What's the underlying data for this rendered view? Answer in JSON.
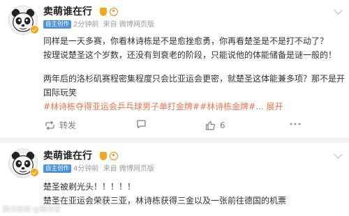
{
  "posts": [
    {
      "author": "卖萌谁在行",
      "tag": "自主创作",
      "time": "2分钟前",
      "source": "来自 微博网页版",
      "lines": [
        "同样是一天多赛，你看林诗栋是不是愈挫愈勇，你再看楚圣是不是打不动了？",
        "按理说楚圣这个岁数，还没有到衰老的阶段，只能说他的体能储备是谜一般的！",
        "",
        "两年后的洛杉矶赛程密集程度只会比亚运会更密，就楚圣这体能兼多项？那不是开",
        "国际玩笑"
      ],
      "hashtags_line": "#林诗栋夺得亚运会乒乓球男子单打金牌##林诗栋金牌#",
      "suffix": "... 展开",
      "actions": {
        "repost": "转发",
        "comment": "",
        "like": "6"
      }
    },
    {
      "author": "卖萌谁在行",
      "tag": "自主创作",
      "time": "4分钟前",
      "source": "来自 微博网页版",
      "lines": [
        "楚圣被剃光头！！！！！",
        "楚圣在亚运会荣获三亚，林诗栋获得三金以及一张前往德国的机票"
      ]
    }
  ],
  "watermark": "腾讯新闻 @萌评家",
  "colors": {
    "link": "#eb7350",
    "tag": "#4a90e2",
    "badge": "#f7a51c"
  }
}
